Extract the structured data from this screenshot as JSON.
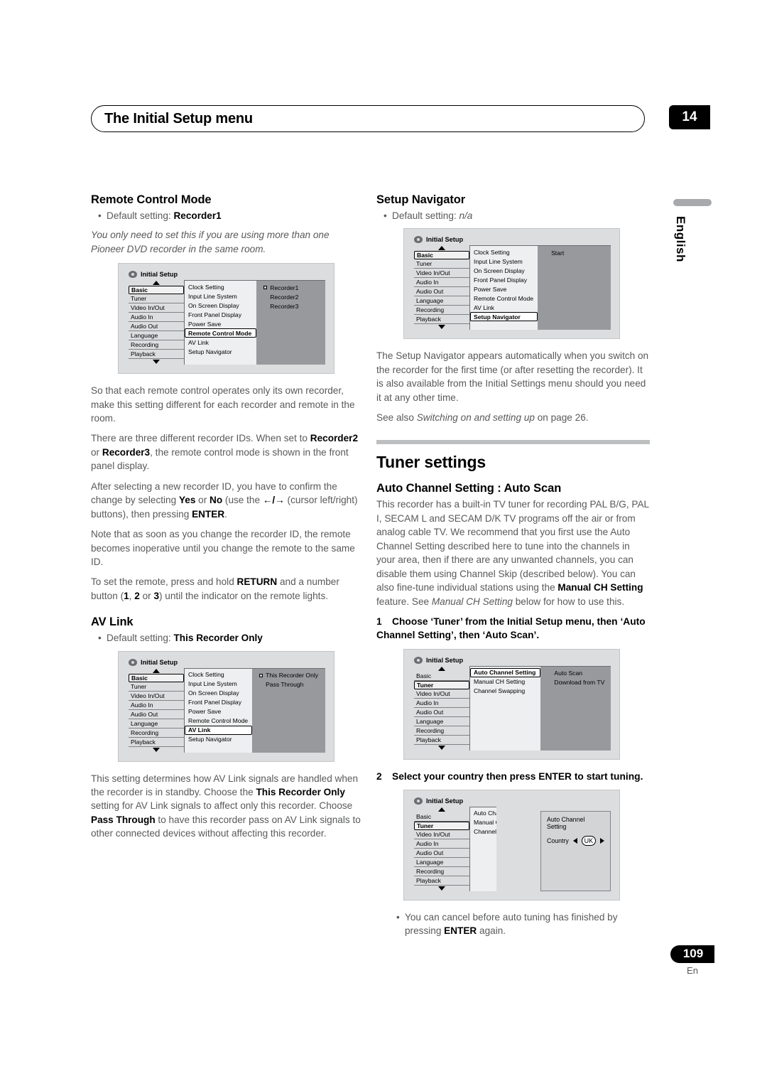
{
  "header": {
    "title": "The Initial Setup menu",
    "chapter": "14"
  },
  "side_tab": {
    "label": "English"
  },
  "footer": {
    "page": "109",
    "lang": "En"
  },
  "menu_common": {
    "osd_title": "Initial Setup",
    "categories": [
      "Basic",
      "Tuner",
      "Video In/Out",
      "Audio In",
      "Audio Out",
      "Language",
      "Recording",
      "Playback"
    ],
    "basic_items": [
      "Clock Setting",
      "Input Line System",
      "On Screen Display",
      "Front Panel Display",
      "Power Save",
      "Remote Control Mode",
      "AV Link",
      "Setup Navigator"
    ],
    "tuner_items": [
      "Auto Channel Setting",
      "Manual CH Setting",
      "Channel Swapping"
    ]
  },
  "left": {
    "remote_control_mode": {
      "heading": "Remote Control Mode",
      "default_label": "Default setting:",
      "default_value": "Recorder1",
      "intro_italic": "You only need to set this if you are using more than one Pioneer DVD recorder in the same room.",
      "menu": {
        "selected_category": "Basic",
        "selected_item": "Remote Control Mode",
        "options": [
          "Recorder1",
          "Recorder2",
          "Recorder3"
        ],
        "selected_option": "Recorder1"
      },
      "para1": "So that each remote control operates only its own recorder, make this setting different for each recorder and remote in the room.",
      "para2_a": "There are three different recorder IDs. When set to ",
      "para2_b1": "Recorder2",
      "para2_c": " or ",
      "para2_b2": "Recorder3",
      "para2_d": ", the remote control mode is shown in the front panel display.",
      "para3_a": "After selecting a new recorder ID, you have to confirm the change by selecting ",
      "para3_b1": "Yes",
      "para3_c": " or ",
      "para3_b2": "No",
      "para3_d": " (use the ",
      "para3_cursor": "←/→",
      "para3_e": " (cursor left/right) buttons), then pressing ",
      "para3_b3": "ENTER",
      "para3_f": ".",
      "para4": "Note that as soon as you change the recorder ID, the remote becomes inoperative until you change the remote to the same ID.",
      "para5_a": "To set the remote, press and hold ",
      "para5_b1": "RETURN",
      "para5_c": " and a number button (",
      "para5_b2": "1",
      "para5_d": ", ",
      "para5_b3": "2",
      "para5_e": " or ",
      "para5_b4": "3",
      "para5_f": ") until the indicator on the remote lights."
    },
    "av_link": {
      "heading": "AV Link",
      "default_label": "Default setting:",
      "default_value": "This Recorder Only",
      "menu": {
        "selected_category": "Basic",
        "selected_item": "AV Link",
        "options": [
          "This Recorder Only",
          "Pass Through"
        ],
        "selected_option": "This Recorder Only"
      },
      "para1_a": "This setting determines how AV Link signals are handled when the recorder is in standby. Choose the ",
      "para1_b1": "This Recorder Only",
      "para1_c": " setting for AV Link signals to affect only this recorder. Choose ",
      "para1_b2": "Pass Through",
      "para1_d": " to have this recorder pass on AV Link signals to other connected devices without affecting this recorder."
    }
  },
  "right": {
    "setup_navigator": {
      "heading": "Setup Navigator",
      "default_label": "Default setting:",
      "default_value": "n/a",
      "menu": {
        "selected_category": "Basic",
        "selected_item": "Setup Navigator",
        "options": [
          "Start"
        ]
      },
      "para1": "The Setup Navigator appears automatically when you switch on the recorder for the first time (or after resetting the recorder). It is also available from the Initial Settings menu should you need it at any other time.",
      "para2_a": "See also ",
      "para2_i": "Switching on and setting up",
      "para2_b": " on page 26."
    },
    "tuner_settings": {
      "heading": "Tuner settings",
      "auto_channel": {
        "heading": "Auto Channel Setting : Auto Scan",
        "para1_a": "This recorder has a built-in TV tuner for recording PAL B/G, PAL I, SECAM L and SECAM D/K TV programs off the air or from analog cable TV. We recommend that you first use the Auto Channel Setting described here to tune into the channels in your area, then if there are any unwanted channels, you can disable them using Channel Skip (described below). You can also fine-tune individual stations using the ",
        "para1_b": "Manual CH Setting",
        "para1_c": " feature. See ",
        "para1_i": "Manual CH Setting",
        "para1_d": " below for how to use this.",
        "step1_num": "1",
        "step1_text": "Choose ‘Tuner’ from the Initial Setup menu, then ‘Auto Channel Setting’, then ‘Auto Scan’.",
        "menu1": {
          "selected_category": "Tuner",
          "selected_item": "Auto Channel Setting",
          "options": [
            "Auto Scan",
            "Download from TV"
          ]
        },
        "step2_num": "2",
        "step2_text": "Select your country then press ENTER to start tuning.",
        "menu2": {
          "selected_category": "Tuner",
          "dialog_title": "Auto Channel Setting",
          "country_label": "Country",
          "country_value": "UK"
        },
        "note_a": "You can cancel before auto tuning has finished by pressing ",
        "note_b": "ENTER",
        "note_c": " again."
      }
    }
  }
}
